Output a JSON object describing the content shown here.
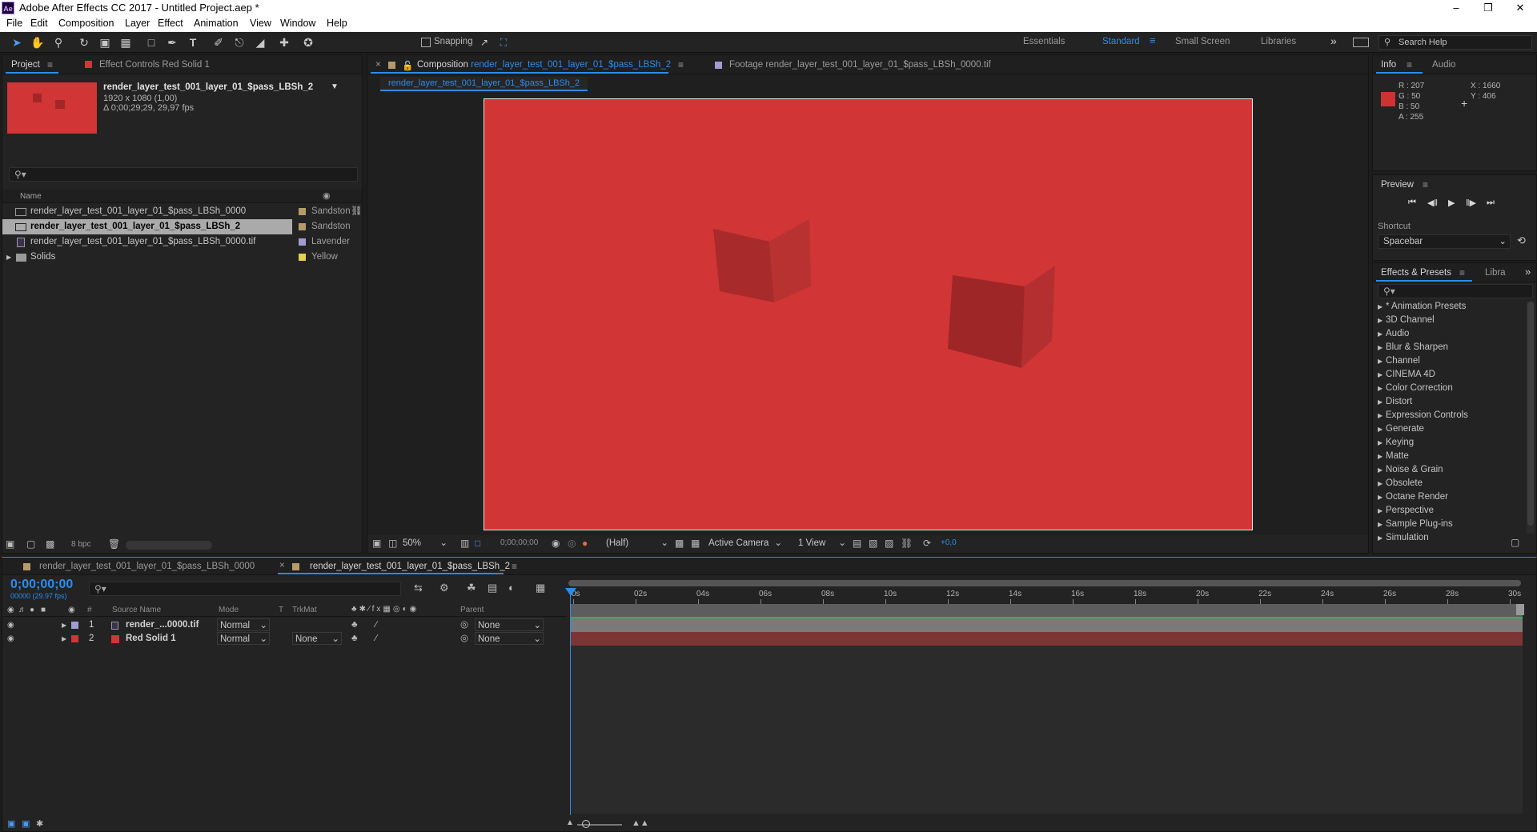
{
  "app": {
    "logo": "Ae",
    "title": "Adobe After Effects CC 2017 - Untitled Project.aep *"
  },
  "menu": [
    "File",
    "Edit",
    "Composition",
    "Layer",
    "Effect",
    "Animation",
    "View",
    "Window",
    "Help"
  ],
  "toolbar": {
    "tools": [
      "selection-tool-icon",
      "hand-tool-icon",
      "zoom-tool-icon",
      "rotate-tool-icon",
      "camera-tool-icon",
      "pan-behind-tool-icon",
      "rectangle-tool-icon",
      "pen-tool-icon",
      "type-tool-icon",
      "brush-tool-icon",
      "clone-stamp-tool-icon",
      "eraser-tool-icon",
      "roto-brush-tool-icon",
      "puppet-pin-tool-icon"
    ],
    "snapping": "Snapping",
    "workspaces": [
      "Essentials",
      "Standard",
      "Small Screen",
      "Libraries"
    ],
    "active_workspace": "Standard",
    "search_help": "Search Help"
  },
  "project": {
    "tab": "Project",
    "effect_controls_tab": "Effect Controls Red Solid 1",
    "selected_name": "render_layer_test_001_layer_01_$pass_LBSh_2",
    "selected_info1": "1920 x 1080 (1,00)",
    "selected_info2": "Δ 0;00;29;29, 29,97 fps",
    "search_placeholder": "",
    "col_name": "Name",
    "items": [
      {
        "name": "render_layer_test_001_layer_01_$pass_LBSh_0000",
        "label": "Sandston",
        "color": "#b59b6c",
        "icon": "composition-icon"
      },
      {
        "name": "render_layer_test_001_layer_01_$pass_LBSh_2",
        "label": "Sandston",
        "color": "#b59b6c",
        "icon": "composition-icon",
        "selected": true
      },
      {
        "name": "render_layer_test_001_layer_01_$pass_LBSh_0000.tif",
        "label": "Lavender",
        "color": "#a09bd0",
        "icon": "footage-icon"
      },
      {
        "name": "Solids",
        "label": "Yellow",
        "color": "#e3d04b",
        "icon": "folder-icon"
      }
    ],
    "bpc": "8 bpc"
  },
  "viewer": {
    "comp_tab_prefix": "Composition",
    "comp_tab_name": "render_layer_test_001_layer_01_$pass_LBSh_2",
    "footage_tab": "Footage render_layer_test_001_layer_01_$pass_LBSh_0000.tif",
    "breadcrumb": "render_layer_test_001_layer_01_$pass_LBSh_2",
    "canvas_color": "#d13535",
    "zoom": "50%",
    "timecode": "0;00;00;00",
    "resolution": "(Half)",
    "camera": "Active Camera",
    "views": "1 View",
    "exposure": "+0,0"
  },
  "info": {
    "tab": "Info",
    "audio_tab": "Audio",
    "r": "R : 207",
    "g": "G : 50",
    "b": "B : 50",
    "a": "A : 255",
    "x": "X : 1660",
    "y": "Y : 406",
    "swatch": "#cf3232"
  },
  "preview": {
    "title": "Preview",
    "shortcut_label": "Shortcut",
    "shortcut_value": "Spacebar"
  },
  "effects": {
    "tab": "Effects & Presets",
    "libraries_tab": "Libra",
    "items": [
      "* Animation Presets",
      "3D Channel",
      "Audio",
      "Blur & Sharpen",
      "Channel",
      "CINEMA 4D",
      "Color Correction",
      "Distort",
      "Expression Controls",
      "Generate",
      "Keying",
      "Matte",
      "Noise & Grain",
      "Obsolete",
      "Octane Render",
      "Perspective",
      "Sample Plug-ins",
      "Simulation"
    ]
  },
  "timeline": {
    "tab1": "render_layer_test_001_layer_01_$pass_LBSh_0000",
    "tab2": "render_layer_test_001_layer_01_$pass_LBSh_2",
    "timecode": "0;00;00;00",
    "timecode_sub": "00000 (29.97 fps)",
    "headers": {
      "num": "#",
      "source": "Source Name",
      "mode": "Mode",
      "t": "T",
      "trkmat": "TrkMat",
      "parent": "Parent"
    },
    "ruler": [
      "0s",
      "02s",
      "04s",
      "06s",
      "08s",
      "10s",
      "12s",
      "14s",
      "16s",
      "18s",
      "20s",
      "22s",
      "24s",
      "26s",
      "28s",
      "30s"
    ],
    "layers": [
      {
        "num": "1",
        "name": "render_...0000.tif",
        "color": "#a09bd0",
        "mode": "Normal",
        "trkmat": "",
        "parent": "None",
        "bar": "#7a7a7a"
      },
      {
        "num": "2",
        "name": "Red Solid 1",
        "color": "#d13535",
        "mode": "Normal",
        "trkmat": "None",
        "parent": "None",
        "bar": "#7d3434"
      }
    ]
  }
}
